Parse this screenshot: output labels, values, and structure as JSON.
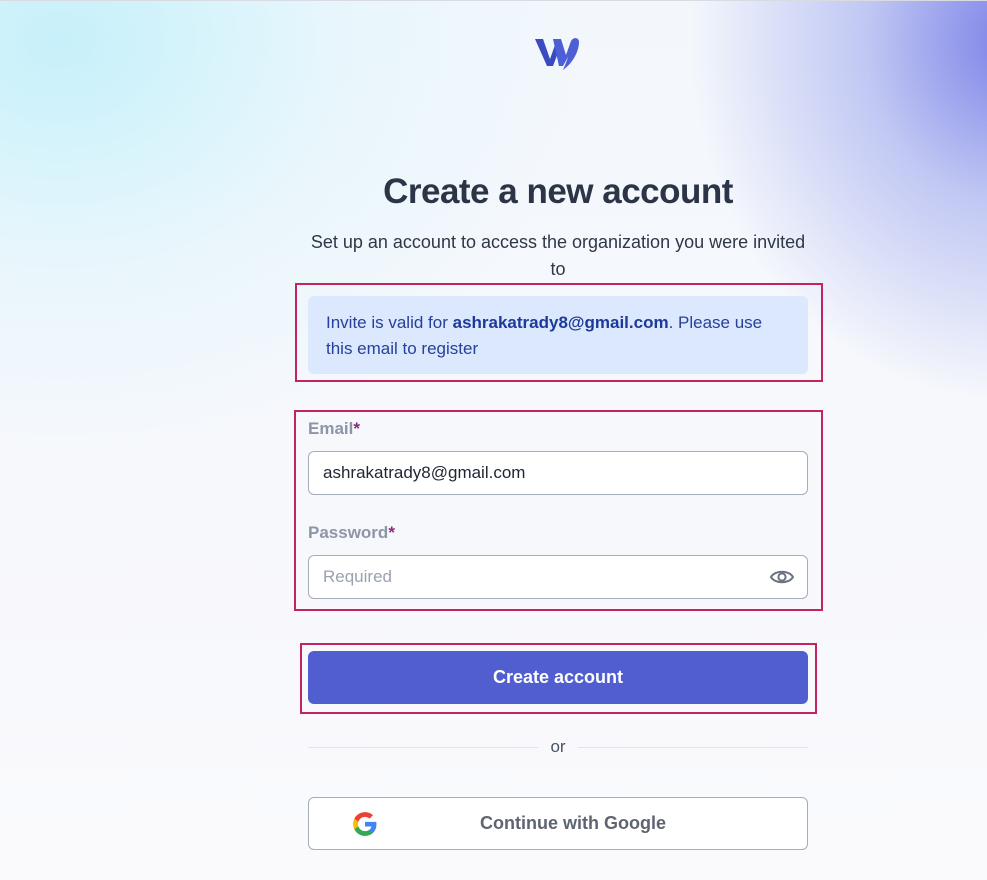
{
  "header": {
    "logo_icon": "brand-w-logo-icon"
  },
  "signup": {
    "title": "Create a new account",
    "subtitle": "Set up an account to access the organization you were invited to",
    "invite": {
      "prefix": "Invite is valid for ",
      "email": "ashrakatrady8@gmail.com",
      "suffix": ". Please use this email to register"
    },
    "email_field": {
      "label": "Email",
      "required_mark": "*",
      "value": "ashrakatrady8@gmail.com"
    },
    "password_field": {
      "label": "Password",
      "required_mark": "*",
      "placeholder": "Required",
      "toggle_icon": "eye-icon"
    },
    "create_button": "Create account",
    "divider_text": "or",
    "google_button": "Continue with Google",
    "google_icon": "google-icon"
  },
  "colors": {
    "primary": "#505ecf",
    "highlight_border": "#c4245e",
    "invite_bg": "#dbe8fd",
    "heading": "#2c3548"
  }
}
